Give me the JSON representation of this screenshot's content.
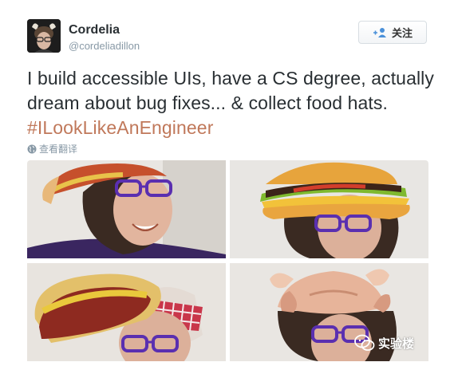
{
  "tweet": {
    "author_name": "Cordelia",
    "author_handle": "@cordeliadillon",
    "follow_label": "关注",
    "text_plain": "I build accessible UIs, have a CS degree, actually dream about bug fixes... & collect food hats.",
    "hashtag": "#ILookLikeAnEngineer",
    "translate_label": "查看翻译"
  },
  "photos": [
    {
      "alt": "woman in purple glasses wearing hot dog hat, smiling"
    },
    {
      "alt": "woman in purple glasses wearing hamburger hat"
    },
    {
      "alt": "woman in purple glasses wearing hot dog hat with checkered cloth"
    },
    {
      "alt": "woman in purple glasses wearing roast turkey hat"
    }
  ],
  "watermark": {
    "text": "实验楼"
  },
  "colors": {
    "hashtag": "#c0785a",
    "text": "#292f33",
    "muted": "#8899a6",
    "glasses": "#5a2fb0"
  },
  "icons": {
    "follow": "add-user-icon",
    "translate": "globe-icon",
    "watermark": "wechat-icon"
  }
}
